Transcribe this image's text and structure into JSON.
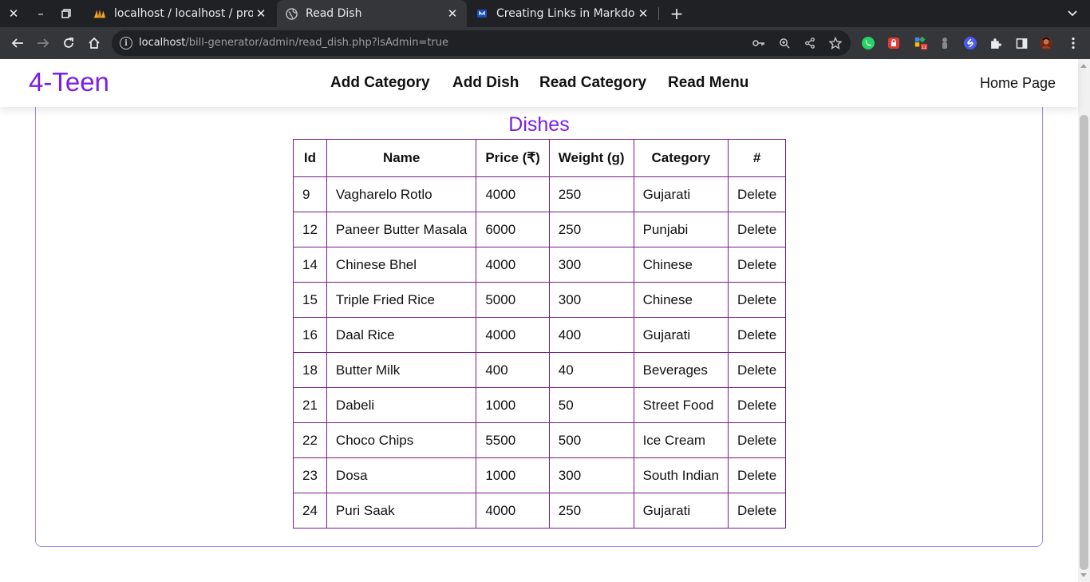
{
  "browser": {
    "tabs": [
      {
        "title": "localhost / localhost / proje",
        "favicon": "phpmyadmin-icon",
        "active": false
      },
      {
        "title": "Read Dish",
        "favicon": "globe-icon",
        "active": true
      },
      {
        "title": "Creating Links in Markdown",
        "favicon": "markdown-icon",
        "active": false
      }
    ],
    "url_host": "localhost",
    "url_path": "/bill-generator/admin/read_dish.php?isAdmin=true"
  },
  "navbar": {
    "brand": "4-Teen",
    "links": [
      "Add Category",
      "Add Dish",
      "Read Category",
      "Read Menu"
    ],
    "home": "Home Page"
  },
  "main": {
    "title": "Dishes",
    "columns": [
      "Id",
      "Name",
      "Price (₹)",
      "Weight (g)",
      "Category",
      "#"
    ],
    "rows": [
      [
        "9",
        "Vagharelo Rotlo",
        "4000",
        "250",
        "Gujarati",
        "Delete"
      ],
      [
        "12",
        "Paneer Butter Masala",
        "6000",
        "250",
        "Punjabi",
        "Delete"
      ],
      [
        "14",
        "Chinese Bhel",
        "4000",
        "300",
        "Chinese",
        "Delete"
      ],
      [
        "15",
        "Triple Fried Rice",
        "5000",
        "300",
        "Chinese",
        "Delete"
      ],
      [
        "16",
        "Daal Rice",
        "4000",
        "400",
        "Gujarati",
        "Delete"
      ],
      [
        "18",
        "Butter Milk",
        "400",
        "40",
        "Beverages",
        "Delete"
      ],
      [
        "21",
        "Dabeli",
        "1000",
        "50",
        "Street Food",
        "Delete"
      ],
      [
        "22",
        "Choco Chips",
        "5500",
        "500",
        "Ice Cream",
        "Delete"
      ],
      [
        "23",
        "Dosa",
        "1000",
        "300",
        "South Indian",
        "Delete"
      ],
      [
        "24",
        "Puri Saak",
        "4000",
        "250",
        "Gujarati",
        "Delete"
      ]
    ]
  },
  "colors": {
    "brand": "#7a1ee6",
    "table_border": "#7a1a8c",
    "card_border": "#9d8ef0"
  }
}
